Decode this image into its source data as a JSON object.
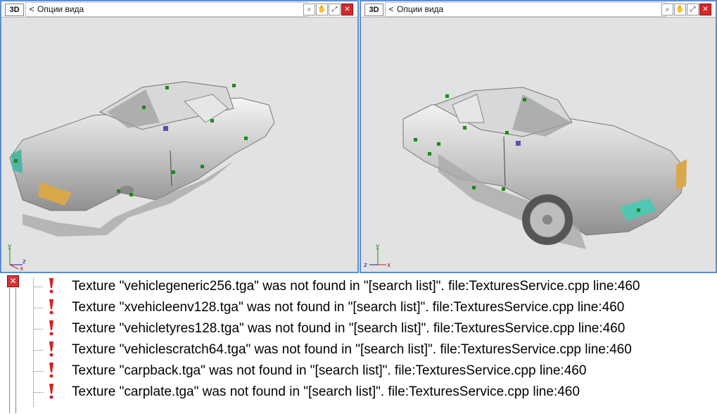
{
  "viewports": [
    {
      "mode_label": "3D",
      "menu_label": "Опции вида",
      "axes": {
        "up": "y",
        "side": "z",
        "front": "x"
      }
    },
    {
      "mode_label": "3D",
      "menu_label": "Опции вида",
      "axes": {
        "up": "y",
        "side": "z",
        "front": "x"
      }
    }
  ],
  "toolbar_icons": [
    "zoom-icon",
    "pan-hand-icon",
    "maximize-icon",
    "close-view-icon"
  ],
  "log": {
    "entries": [
      {
        "text": "Texture \"vehiclegeneric256.tga\" was not found in \"[search list]\". file:TexturesService.cpp line:460"
      },
      {
        "text": "Texture \"xvehicleenv128.tga\" was not found in \"[search list]\". file:TexturesService.cpp line:460"
      },
      {
        "text": "Texture \"vehicletyres128.tga\" was not found in \"[search list]\". file:TexturesService.cpp line:460"
      },
      {
        "text": "Texture \"vehiclescratch64.tga\" was not found in \"[search list]\". file:TexturesService.cpp line:460"
      },
      {
        "text": "Texture \"carpback.tga\" was not found in \"[search list]\". file:TexturesService.cpp line:460"
      },
      {
        "text": "Texture \"carplate.tga\" was not found in \"[search list]\". file:TexturesService.cpp line:460"
      }
    ]
  },
  "colors": {
    "viewport_bg": "#e2e2e2",
    "viewport_border": "#5a8fd6",
    "error_icon": "#d42020",
    "helper_points": "#1a8a1a"
  }
}
